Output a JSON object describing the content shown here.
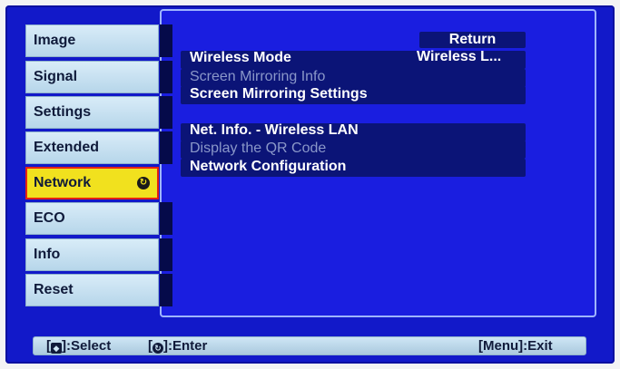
{
  "sidebar": {
    "items": [
      {
        "label": "Image"
      },
      {
        "label": "Signal"
      },
      {
        "label": "Settings"
      },
      {
        "label": "Extended"
      },
      {
        "label": "Network",
        "active": true
      },
      {
        "label": "ECO"
      },
      {
        "label": "Info"
      },
      {
        "label": "Reset"
      }
    ]
  },
  "main": {
    "return_label": "Return",
    "items": [
      {
        "label": "Wireless Mode",
        "value": "Wireless L...",
        "enabled": true
      },
      {
        "label": "Screen Mirroring Info",
        "enabled": false
      },
      {
        "label": "Screen Mirroring Settings",
        "enabled": true
      },
      {
        "label": "Net. Info. - Wireless LAN",
        "enabled": true
      },
      {
        "label": "Display the QR Code",
        "enabled": false
      },
      {
        "label": "Network Configuration",
        "enabled": true
      }
    ]
  },
  "footer": {
    "select_open": "[",
    "select_label": "]:Select",
    "enter_open": "[",
    "enter_label": "]:Enter",
    "menu_exit": "[Menu]:Exit"
  },
  "icons": {
    "nav": "updown-arrow-icon",
    "enter": "enter-icon"
  },
  "colors": {
    "screen_bg": "#1219c9",
    "tab_bg": "#c6e0f1",
    "active_tab_bg": "#f1e11e",
    "active_tab_border": "#e52313",
    "dim_text": "#8a97c9"
  }
}
